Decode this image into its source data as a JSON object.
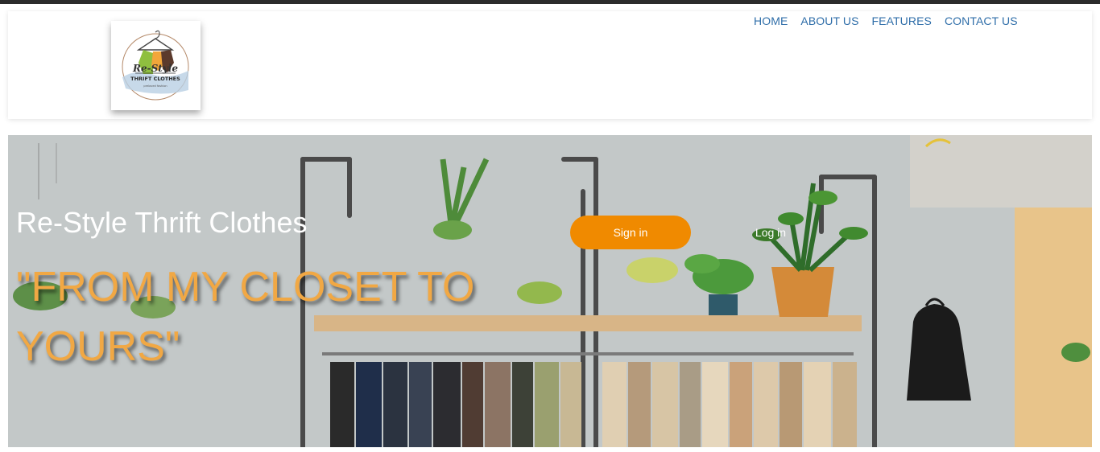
{
  "logo": {
    "line1": "Re-Style",
    "line2": "THRIFT CLOTHES",
    "line3": "preloved fashion"
  },
  "nav": {
    "items": [
      "HOME",
      "ABOUT US",
      "FEATURES",
      "CONTACT US"
    ]
  },
  "hero": {
    "brand": "Re-Style Thrift Clothes",
    "slogan": "\"FROM MY CLOSET TO YOURS\"",
    "signin_label": "Sign in",
    "login_label": "Log in"
  },
  "colors": {
    "nav_link": "#2f6ea9",
    "signin_button": "#f08a00",
    "slogan": "#f1a844",
    "top_bar": "#2b2b2b"
  }
}
